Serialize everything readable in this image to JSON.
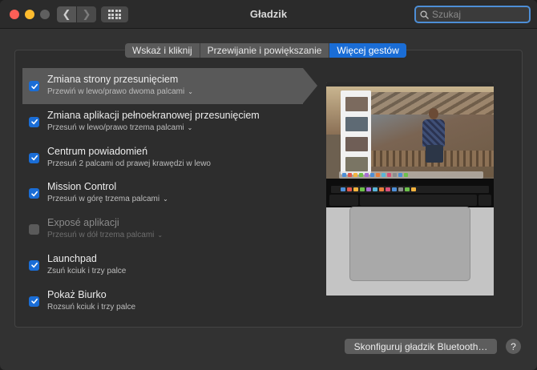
{
  "window": {
    "title": "Gładzik"
  },
  "search": {
    "placeholder": "Szukaj",
    "icon": "search-icon"
  },
  "tabs": [
    {
      "label": "Wskaż i kliknij",
      "active": false
    },
    {
      "label": "Przewijanie i powiększanie",
      "active": false
    },
    {
      "label": "Więcej gestów",
      "active": true
    }
  ],
  "gestures": [
    {
      "title": "Zmiana strony przesunięciem",
      "subtitle": "Przewiń w lewo/prawo dwoma palcami",
      "checked": true,
      "has_dropdown": true,
      "selected": true,
      "enabled": true
    },
    {
      "title": "Zmiana aplikacji pełnoekranowej przesunięciem",
      "subtitle": "Przesuń w lewo/prawo trzema palcami",
      "checked": true,
      "has_dropdown": true,
      "selected": false,
      "enabled": true
    },
    {
      "title": "Centrum powiadomień",
      "subtitle": "Przesuń 2 palcami od prawej krawędzi w lewo",
      "checked": true,
      "has_dropdown": false,
      "selected": false,
      "enabled": true
    },
    {
      "title": "Mission Control",
      "subtitle": "Przesuń w górę trzema palcami",
      "checked": true,
      "has_dropdown": true,
      "selected": false,
      "enabled": true
    },
    {
      "title": "Exposé aplikacji",
      "subtitle": "Przesuń w dół trzema palcami",
      "checked": false,
      "has_dropdown": true,
      "selected": false,
      "enabled": false
    },
    {
      "title": "Launchpad",
      "subtitle": "Zsuń kciuk i trzy palce",
      "checked": true,
      "has_dropdown": false,
      "selected": false,
      "enabled": true
    },
    {
      "title": "Pokaż Biurko",
      "subtitle": "Rozsuń kciuk i trzy palce",
      "checked": true,
      "has_dropdown": false,
      "selected": false,
      "enabled": true
    }
  ],
  "bottom": {
    "bluetooth_button": "Skonfiguruj gładzik Bluetooth…",
    "help_label": "?"
  },
  "colors": {
    "accent": "#1a6dd6",
    "selected_row": "#595959",
    "close": "#fe5f57",
    "minimize": "#febc2e"
  }
}
